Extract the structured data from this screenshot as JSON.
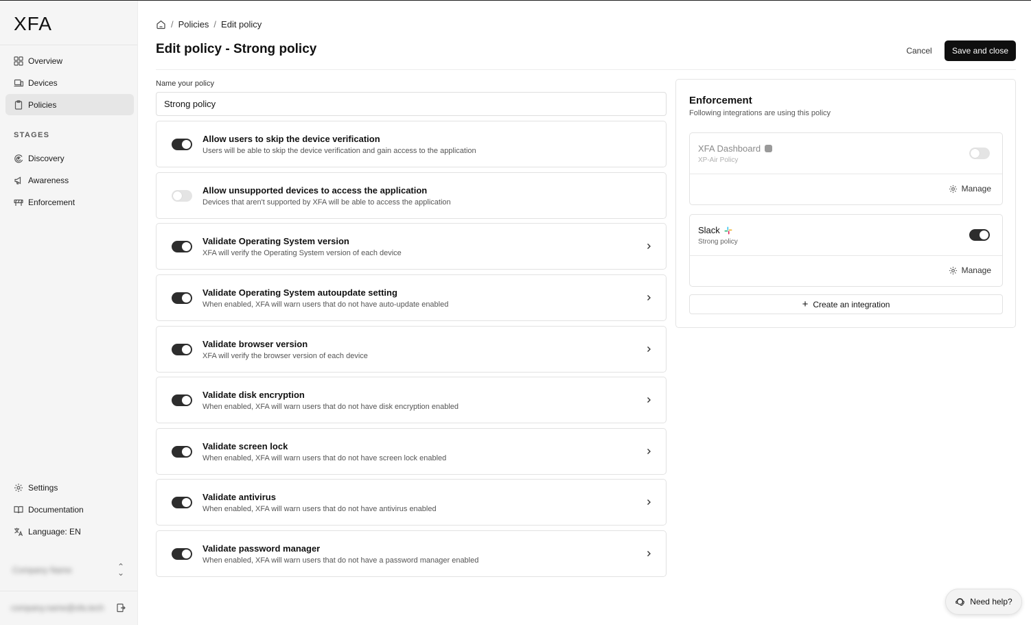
{
  "brand": {
    "logo": "XFA"
  },
  "sidebar": {
    "nav": [
      {
        "label": "Overview",
        "icon": "grid-icon"
      },
      {
        "label": "Devices",
        "icon": "devices-icon"
      },
      {
        "label": "Policies",
        "icon": "clipboard-icon"
      }
    ],
    "stages_label": "STAGES",
    "stages": [
      {
        "label": "Discovery",
        "icon": "discovery-icon"
      },
      {
        "label": "Awareness",
        "icon": "megaphone-icon"
      },
      {
        "label": "Enforcement",
        "icon": "barrier-icon"
      }
    ],
    "bottom": [
      {
        "label": "Settings",
        "icon": "gear-icon"
      },
      {
        "label": "Documentation",
        "icon": "book-icon"
      },
      {
        "label": "Language: EN",
        "icon": "translate-icon"
      }
    ],
    "company_name": "Company Name",
    "user_email": "company.name@xfa.tech"
  },
  "breadcrumb": {
    "items": [
      "Policies",
      "Edit policy"
    ]
  },
  "header": {
    "title": "Edit policy - Strong policy",
    "cancel_label": "Cancel",
    "save_label": "Save and close"
  },
  "form": {
    "name_label": "Name your policy",
    "name_value": "Strong policy"
  },
  "policies": [
    {
      "title": "Allow users to skip the device verification",
      "desc": "Users will be able to skip the device verification and gain access to the application",
      "enabled": true,
      "expandable": false
    },
    {
      "title": "Allow unsupported devices to access the application",
      "desc": "Devices that aren't supported by XFA will be able to access the application",
      "enabled": false,
      "expandable": false
    },
    {
      "title": "Validate Operating System version",
      "desc": "XFA will verify the Operating System version of each device",
      "enabled": true,
      "expandable": true
    },
    {
      "title": "Validate Operating System autoupdate setting",
      "desc": "When enabled, XFA will warn users that do not have auto-update enabled",
      "enabled": true,
      "expandable": true
    },
    {
      "title": "Validate browser version",
      "desc": "XFA will verify the browser version of each device",
      "enabled": true,
      "expandable": true
    },
    {
      "title": "Validate disk encryption",
      "desc": "When enabled, XFA will warn users that do not have disk encryption enabled",
      "enabled": true,
      "expandable": true
    },
    {
      "title": "Validate screen lock",
      "desc": "When enabled, XFA will warn users that do not have screen lock enabled",
      "enabled": true,
      "expandable": true
    },
    {
      "title": "Validate antivirus",
      "desc": "When enabled, XFA will warn users that do not have antivirus enabled",
      "enabled": true,
      "expandable": true
    },
    {
      "title": "Validate password manager",
      "desc": "When enabled, XFA will warn users that do not have a password manager enabled",
      "enabled": true,
      "expandable": true
    }
  ],
  "enforcement": {
    "title": "Enforcement",
    "subtitle": "Following integrations are using this policy",
    "integrations": [
      {
        "name": "XFA Dashboard",
        "policy": "XP-Air Policy",
        "enabled": false,
        "muted": true,
        "manage_label": "Manage"
      },
      {
        "name": "Slack",
        "policy": "Strong policy",
        "enabled": true,
        "muted": false,
        "manage_label": "Manage"
      }
    ],
    "create_label": "Create an integration"
  },
  "help": {
    "label": "Need help?"
  },
  "colors": {
    "primary": "#0f0f0f",
    "sidebar_bg": "#f5f5f5",
    "toggle_on": "#2d2d2d",
    "toggle_off": "#e4e4e4"
  }
}
